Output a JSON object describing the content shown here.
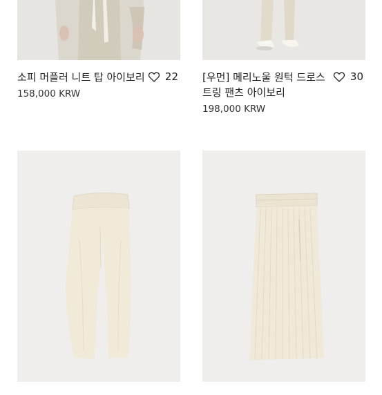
{
  "products": [
    {
      "name": "소피 머플러 니트 탑 아이보리",
      "price": "158,000 KRW",
      "likes": "22"
    },
    {
      "name": "[우먼] 메리노울 원턱 드로스트링 팬츠 아이보리",
      "price": "198,000 KRW",
      "likes": "30"
    },
    {
      "name": "",
      "price": "",
      "likes": ""
    },
    {
      "name": "",
      "price": "",
      "likes": ""
    }
  ],
  "icons": {
    "like": "heart-outline-icon"
  }
}
